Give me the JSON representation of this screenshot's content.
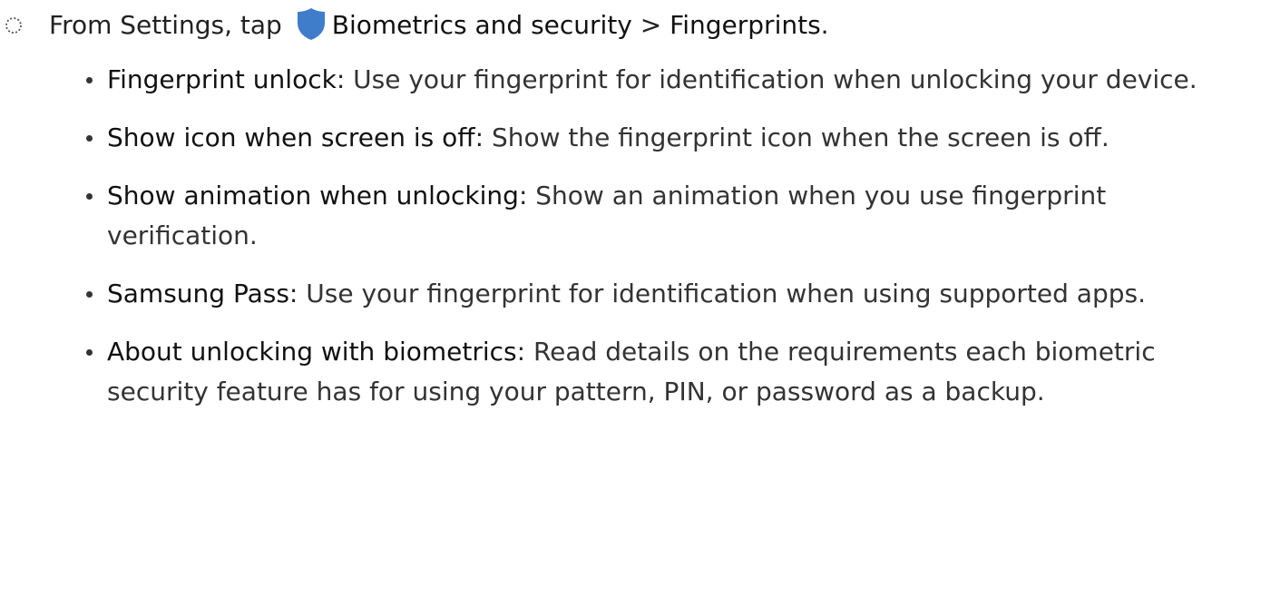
{
  "step": {
    "prefix": "From Settings, tap",
    "item": "Biometrics and security",
    "separator": ">",
    "subitem": "Fingerprints",
    "end": ".",
    "icon": "shield-icon",
    "icon_color": "#3F7DCB"
  },
  "options": [
    {
      "label": "Fingerprint unlock",
      "separator": ": ",
      "description": "Use your fingerprint for identification when unlocking your device."
    },
    {
      "label": "Show icon when screen is off",
      "separator": ": ",
      "description": "Show the fingerprint icon when the screen is off."
    },
    {
      "label": "Show animation when unlocking",
      "separator": ": ",
      "description": "Show an animation when you use fingerprint verification."
    },
    {
      "label": "Samsung Pass",
      "separator": ": ",
      "description": "Use your fingerprint for identification when using supported apps."
    },
    {
      "label": "About unlocking with biometrics",
      "separator": ": ",
      "description": "Read details on the requirements each biometric security feature has for using your pattern, PIN, or password as a backup."
    }
  ]
}
